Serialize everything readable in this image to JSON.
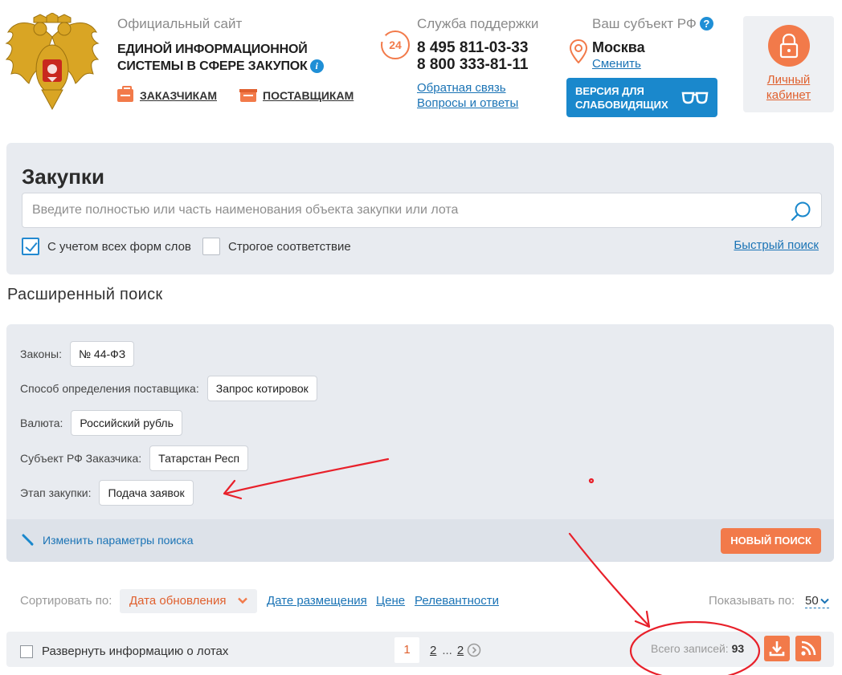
{
  "header": {
    "official_label": "Официальный сайт",
    "site_title_line1": "ЕДИНОЙ ИНФОРМАЦИОННОЙ",
    "site_title_line2": "СИСТЕМЫ В СФЕРЕ ЗАКУПОК",
    "customers_link": "ЗАКАЗЧИКАМ",
    "suppliers_link": "ПОСТАВЩИКАМ",
    "support": {
      "title": "Служба поддержки",
      "icon_text": "24",
      "phone1": "8 495 811-03-33",
      "phone2": "8 800 333-81-11",
      "feedback_link": "Обратная связь",
      "faq_link": "Вопросы и ответы"
    },
    "region": {
      "title": "Ваш субъект РФ",
      "help_icon": "?",
      "name": "Москва",
      "change_link": "Сменить"
    },
    "low_vision_line1": "ВЕРСИЯ ДЛЯ",
    "low_vision_line2": "СЛАБОВИДЯЩИХ",
    "cabinet_line1": "Личный",
    "cabinet_line2": "кабинет"
  },
  "search": {
    "title": "Закупки",
    "placeholder": "Введите полностью или часть наименования объекта закупки или лота",
    "value": "",
    "morph_label": "С учетом всех форм слов",
    "morph_checked": true,
    "strict_label": "Строгое соответствие",
    "strict_checked": false,
    "quick_search_link": "Быстрый поиск"
  },
  "advanced": {
    "title": "Расширенный поиск",
    "filters": [
      {
        "label": "Законы:",
        "value": "№ 44-ФЗ"
      },
      {
        "label": "Способ определения поставщика:",
        "value": "Запрос котировок"
      },
      {
        "label": "Валюта:",
        "value": "Российский рубль"
      },
      {
        "label": "Субъект РФ Заказчика:",
        "value": "Татарстан Респ"
      },
      {
        "label": "Этап закупки:",
        "value": "Подача заявок"
      }
    ],
    "edit_link": "Изменить параметры поиска",
    "new_search_button": "НОВЫЙ ПОИСК"
  },
  "sort": {
    "label": "Сортировать по:",
    "active": "Дата обновления",
    "options": [
      "Дате размещения",
      "Цене",
      "Релевантности"
    ],
    "show_label": "Показывать по:",
    "per_page": "50"
  },
  "results": {
    "expand_label": "Развернуть информацию о лотах",
    "pages": {
      "current": "1",
      "next": "2",
      "dots": "...",
      "last": "2"
    },
    "total_label": "Всего записей:",
    "total_value": "93"
  },
  "colors": {
    "accent_orange": "#f27a4a",
    "link_blue": "#1a73b5",
    "panel_gray": "#e8ebf0",
    "annotation_red": "#e8202a"
  }
}
